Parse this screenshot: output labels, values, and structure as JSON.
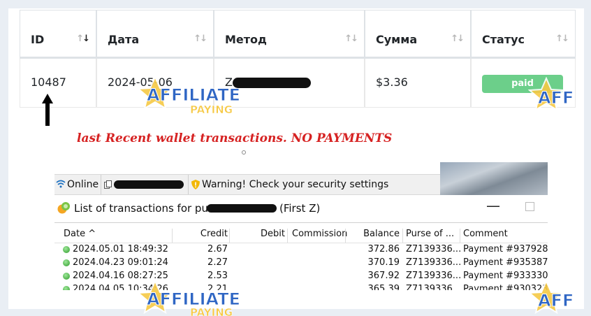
{
  "table": {
    "headers": [
      "ID",
      "Дата",
      "Метод",
      "Сумма",
      "Статус"
    ],
    "row": {
      "id": "10487",
      "date": "2024-05-06",
      "method": "Z",
      "amount": "$3.36",
      "status": "paid"
    }
  },
  "annotation": "last Recent wallet transactions. NO PAYMENTS",
  "status_bar": {
    "online": "Online",
    "warning": "Warning! Check your security settings"
  },
  "purse": {
    "title": "List of transactions for purse",
    "suffix": "(First Z)"
  },
  "transactions": {
    "columns": [
      "Date",
      "Credit",
      "Debit",
      "Commission",
      "Balance",
      "Purse of ...",
      "Comment"
    ],
    "sort_indicator": "^",
    "rows": [
      {
        "date": "2024.05.01 18:49:32",
        "credit": "2.67",
        "balance": "372.86",
        "purse": "Z7139336...",
        "comment": "Payment #937928"
      },
      {
        "date": "2024.04.23 09:01:24",
        "credit": "2.27",
        "balance": "370.19",
        "purse": "Z7139336...",
        "comment": "Payment #935387"
      },
      {
        "date": "2024.04.16 08:27:25",
        "credit": "2.53",
        "balance": "367.92",
        "purse": "Z7139336...",
        "comment": "Payment #933330"
      },
      {
        "date": "2024.04.05 10:34:26",
        "credit": "2.21",
        "balance": "365.39",
        "purse": "Z7139336...",
        "comment": "Payment #930323"
      }
    ]
  },
  "watermark": {
    "line1": "AFFILIATE",
    "line2": "PAYING"
  },
  "colors": {
    "status_paid": "#6ccf8a",
    "annotation": "#d62222",
    "credit_icon": "#2e9a2a"
  }
}
